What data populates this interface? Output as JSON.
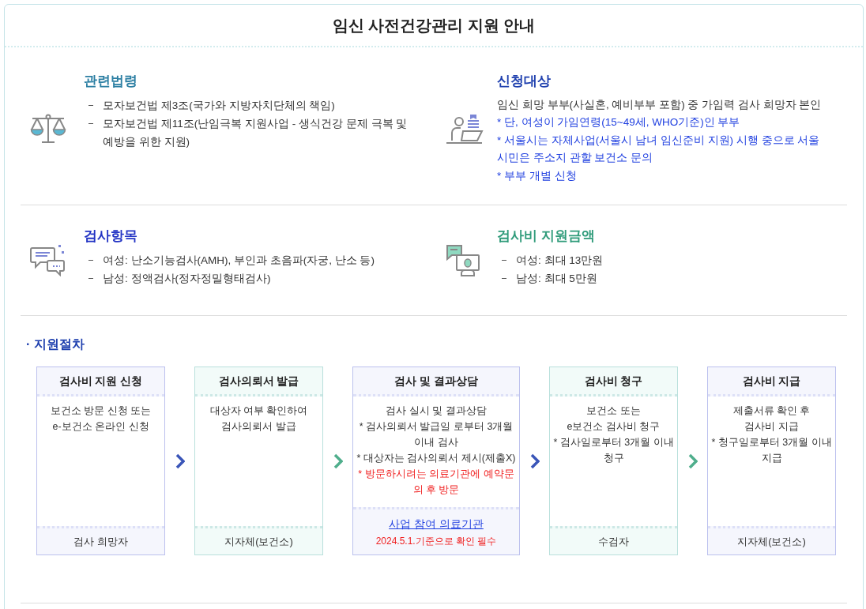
{
  "title": "임신 사전건강관리 지원 안내",
  "sections": [
    {
      "heading": "관련법령",
      "color": "#2c7fa3",
      "lines": [
        {
          "kind": "dash",
          "text": "모자보건법 제3조(국가와 지방자치단체의 책임)"
        },
        {
          "kind": "dash",
          "text": "모자보건법 제11조(난임극복 지원사업 - 생식건강 문제 극복 및 예방을 위한 지원)"
        }
      ]
    },
    {
      "heading": "신청대상",
      "color": "#1e3fae",
      "lines": [
        {
          "kind": "plain",
          "text": "임신 희망 부부(사실혼, 예비부부 포함) 중 가임력 검사 희망자 본인"
        },
        {
          "kind": "note",
          "text": "* 단, 여성이 가임연령(15~49세, WHO기준)인 부부"
        },
        {
          "kind": "note",
          "text": "* 서울시는 자체사업(서울시 남녀 임신준비 지원) 시행 중으로 서울시민은 주소지 관할 보건소 문의"
        },
        {
          "kind": "note",
          "text": "* 부부 개별 신청"
        }
      ]
    },
    {
      "heading": "검사항목",
      "color": "#2233c4",
      "lines": [
        {
          "kind": "dash",
          "text": "여성: 난소기능검사(AMH), 부인과 초음파(자궁, 난소 등)"
        },
        {
          "kind": "dash",
          "text": "남성: 정액검사(정자정밀형태검사)"
        }
      ]
    },
    {
      "heading": "검사비 지원금액",
      "color": "#2f9b7a",
      "lines": [
        {
          "kind": "dash",
          "text": "여성: 최대 13만원"
        },
        {
          "kind": "dash",
          "text": "남성: 최대 5만원"
        }
      ]
    }
  ],
  "procedure": {
    "heading": "· 지원절차",
    "steps": [
      {
        "title": "검사비 지원 신청",
        "lines": [
          {
            "kind": "normal",
            "text": "보건소 방문 신청 또는"
          },
          {
            "kind": "normal",
            "text": "e-보건소 온라인 신청"
          }
        ],
        "footer": "검사 희망자"
      },
      {
        "title": "검사의뢰서 발급",
        "lines": [
          {
            "kind": "normal",
            "text": "대상자 여부 확인하여"
          },
          {
            "kind": "normal",
            "text": "검사의뢰서 발급"
          }
        ],
        "footer": "지자체(보건소)"
      },
      {
        "title": "검사 및 결과상담",
        "lines": [
          {
            "kind": "normal",
            "text": "검사 실시 및 결과상담"
          },
          {
            "kind": "normal",
            "text": "* 검사의뢰서 발급일 로부터 3개월 이내 검사"
          },
          {
            "kind": "normal",
            "text": "* 대상자는 검사의뢰서 제시(제출X)"
          },
          {
            "kind": "warning",
            "text": "* 방문하시려는 의료기관에 예약문의 후 방문"
          }
        ],
        "footer_link": "사업 참여 의료기관",
        "footer_note": "2024.5.1.기준으로 확인 필수"
      },
      {
        "title": "검사비 청구",
        "lines": [
          {
            "kind": "normal",
            "text": "보건소 또는"
          },
          {
            "kind": "normal",
            "text": "e보건소 검사비 청구"
          },
          {
            "kind": "normal",
            "text": "* 검사일로부터 3개월 이내 청구"
          }
        ],
        "footer": "수검자"
      },
      {
        "title": "검사비 지급",
        "lines": [
          {
            "kind": "normal",
            "text": "제출서류 확인 후"
          },
          {
            "kind": "normal",
            "text": "검사비 지급"
          },
          {
            "kind": "normal",
            "text": "* 청구일로부터 3개월 이내 지급"
          }
        ],
        "footer": "지자체(보건소)"
      }
    ]
  }
}
